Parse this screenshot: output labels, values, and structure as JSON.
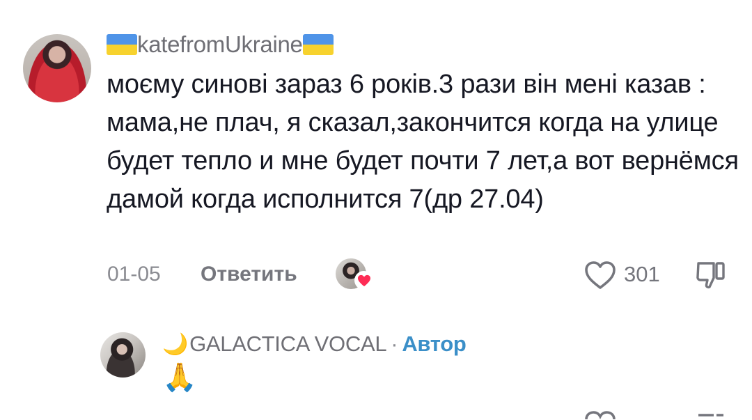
{
  "comment": {
    "username": "katefromUkraine",
    "text": "моєму синові зараз 6 років.3 рази він мені казав : мама,не плач, я сказал,закончится когда на улице будет тепло и мне будет почти 7 лет,а вот вернёмся дамой когда исполнится 7(др 27.04)",
    "date": "01-05",
    "reply_label": "Ответить",
    "like_count": "301"
  },
  "reply": {
    "moon": "🌙",
    "username": "GALACTICA VOCAL",
    "separator": "·",
    "author_label": "Автор",
    "text": "🙏"
  },
  "colors": {
    "author_blue": "#3b8fc8",
    "flag_blue": "#4f94e8",
    "flag_yellow": "#f7d22e",
    "badge_heart": "#fe2c55"
  },
  "icons": [
    "ukraine-flag-icon",
    "heart-icon",
    "dislike-icon",
    "creator-liked-badge-icon"
  ]
}
